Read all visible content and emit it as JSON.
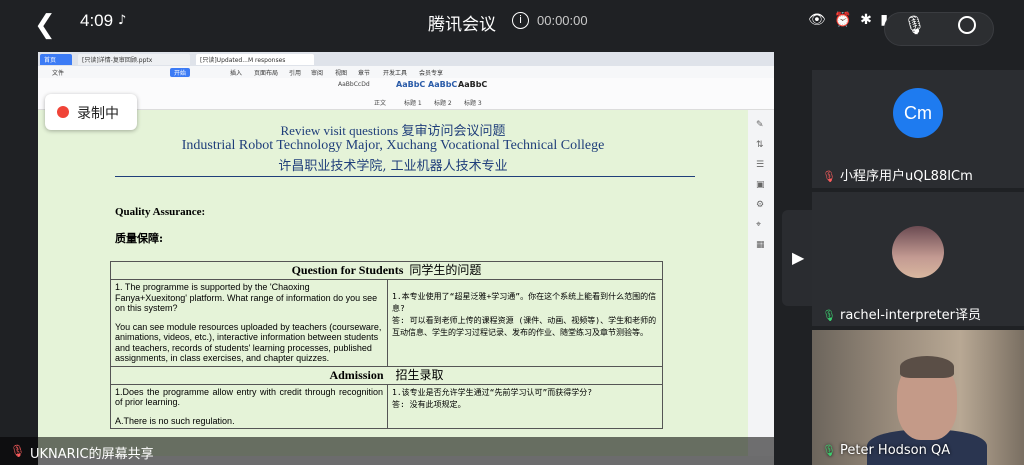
{
  "status": {
    "time": "4:09",
    "app_title": "腾讯会议",
    "timer": "00:00:00"
  },
  "recording": {
    "label": "录制中"
  },
  "share_label": "UKNARIC的屏幕共享",
  "editor": {
    "tabs": [
      "首页",
      "[只读]详情-复审回顾.pptx",
      "[只读]Updated...M responses"
    ],
    "menu": [
      "文件",
      "开始",
      "插入",
      "页面布局",
      "引用",
      "审阅",
      "视图",
      "章节",
      "开发工具",
      "会员专享"
    ],
    "start_label": "开始",
    "styles": [
      "AaBbCcDd",
      "AaBbC",
      "AaBbC",
      "AaBbC"
    ],
    "style_names": [
      "正文",
      "标题 1",
      "标题 2",
      "标题 3"
    ]
  },
  "doc": {
    "title_en_1": "Review visit questions 复审访问会议问题",
    "title_en_2": "Industrial Robot Technology Major, Xuchang Vocational Technical College",
    "title_zh": "许昌职业技术学院, 工业机器人技术专业",
    "qa_en": "Quality Assurance:",
    "qa_zh": "质量保障:",
    "section1_en": "Question for Students",
    "section1_zh": "同学生的问题",
    "q1_en": "1.   The programme is supported by the 'Chaoxing Fanya+Xuexitong' platform. What range of information do you see on this system?",
    "a1_en": "You can see module resources uploaded by teachers (courseware, animations, videos, etc.), interactive information between students and teachers, records of students' learning processes, published assignments, in class exercises, and chapter quizzes.",
    "q1_zh": "1.本专业使用了“超星泛雅+学习通”。你在这个系统上能看到什么范围的信息?",
    "a1_zh": "答: 可以看到老师上传的课程资源 (课件、动画、视频等)、学生和老师的互动信息、学生的学习过程记录、发布的作业、随堂练习及章节测验等。",
    "section2_en": "Admission",
    "section2_zh": "招生录取",
    "q2_en": "1.Does the programme allow entry with credit through recognition of prior learning.",
    "a2_en": "A.There is no such regulation.",
    "q2_zh": "1.该专业是否允许学生通过“先前学习认可”而获得学分?",
    "a2_zh": "答: 没有此项规定。"
  },
  "participants": [
    {
      "initials": "Cm",
      "name": "小程序用户uQL88ICm",
      "avatar_color": "#1e7bf0"
    },
    {
      "name": "rachel-interpreter译员"
    },
    {
      "name": "Peter Hodson QA"
    }
  ]
}
